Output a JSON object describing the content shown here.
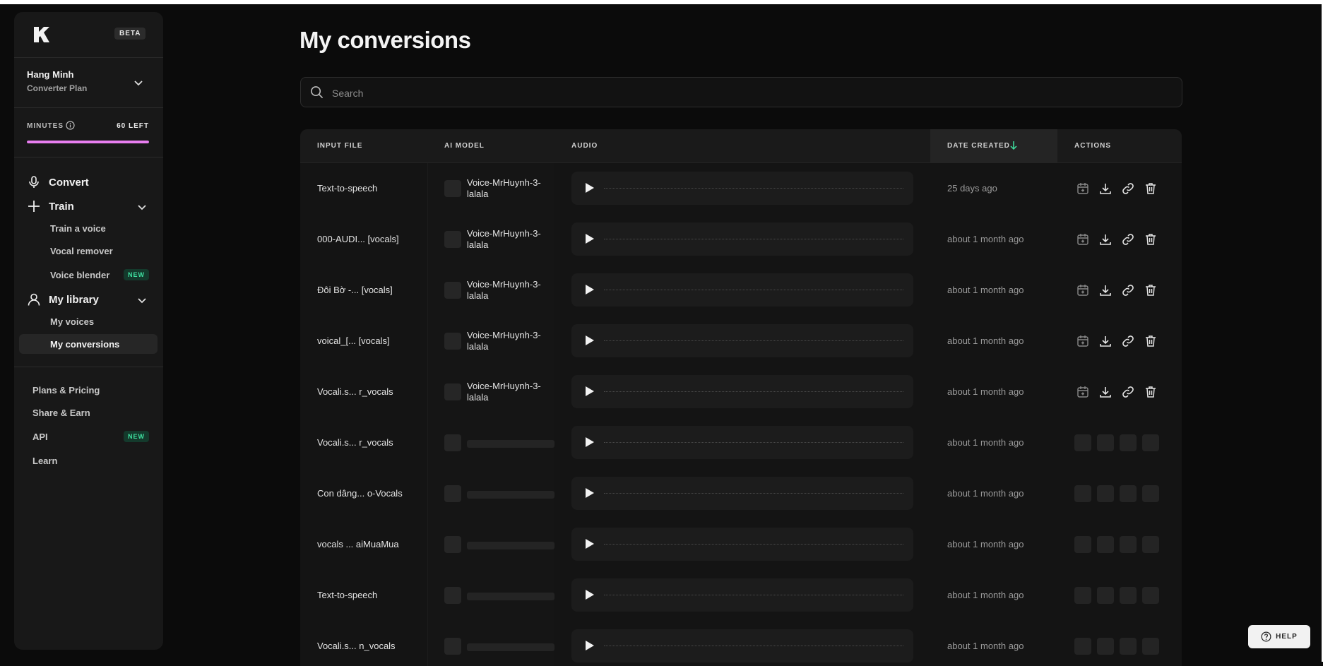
{
  "brand": {
    "beta_label": "BETA"
  },
  "user": {
    "name": "Hang Minh",
    "plan": "Converter Plan"
  },
  "minutes": {
    "label": "MINUTES",
    "left_label": "60 LEFT",
    "progress_fraction": 1.0,
    "bar_color": "#e87ef0"
  },
  "nav": {
    "convert": "Convert",
    "train": "Train",
    "train_items": [
      "Train a voice",
      "Vocal remover",
      "Voice blender"
    ],
    "voice_blender_badge": "NEW",
    "library": "My library",
    "library_items": [
      "My voices",
      "My conversions"
    ],
    "active_item": "My conversions",
    "bottom": [
      "Plans & Pricing",
      "Share & Earn",
      "API",
      "Learn"
    ],
    "api_badge": "NEW"
  },
  "page": {
    "title": "My conversions",
    "search_placeholder": "Search"
  },
  "table": {
    "headers": {
      "input_file": "INPUT FILE",
      "ai_model": "AI MODEL",
      "audio": "AUDIO",
      "date_created": "DATE CREATED",
      "actions": "ACTIONS"
    },
    "sort": {
      "column": "date_created",
      "direction": "descending"
    },
    "rows": [
      {
        "input": "Text-to-speech",
        "model": "Voice-MrHuynh-3-lalala",
        "date": "25 days ago",
        "loaded": true
      },
      {
        "input": "000-AUDI... [vocals]",
        "model": "Voice-MrHuynh-3-lalala",
        "date": "about 1 month ago",
        "loaded": true
      },
      {
        "input": "Đôi Bờ -... [vocals]",
        "model": "Voice-MrHuynh-3-lalala",
        "date": "about 1 month ago",
        "loaded": true
      },
      {
        "input": "voical_[... [vocals]",
        "model": "Voice-MrHuynh-3-lalala",
        "date": "about 1 month ago",
        "loaded": true
      },
      {
        "input": "Vocali.s... r_vocals",
        "model": "Voice-MrHuynh-3-lalala",
        "date": "about 1 month ago",
        "loaded": true
      },
      {
        "input": "Vocali.s... r_vocals",
        "model": "",
        "date": "about 1 month ago",
        "loaded": false
      },
      {
        "input": "Con dâng... o-Vocals",
        "model": "",
        "date": "about 1 month ago",
        "loaded": false
      },
      {
        "input": "vocals ... aiMuaMua",
        "model": "",
        "date": "about 1 month ago",
        "loaded": false
      },
      {
        "input": "Text-to-speech",
        "model": "",
        "date": "about 1 month ago",
        "loaded": false
      },
      {
        "input": "Vocali.s... n_vocals",
        "model": "",
        "date": "about 1 month ago",
        "loaded": false
      }
    ],
    "action_icons": [
      "add-to-calendar-icon",
      "download-icon",
      "link-icon",
      "trash-icon"
    ]
  },
  "help": {
    "label": "HELP"
  },
  "colors": {
    "accent_pink": "#e87ef0",
    "new_badge_text": "#3fe0a0",
    "new_badge_bg": "#143a2c"
  }
}
